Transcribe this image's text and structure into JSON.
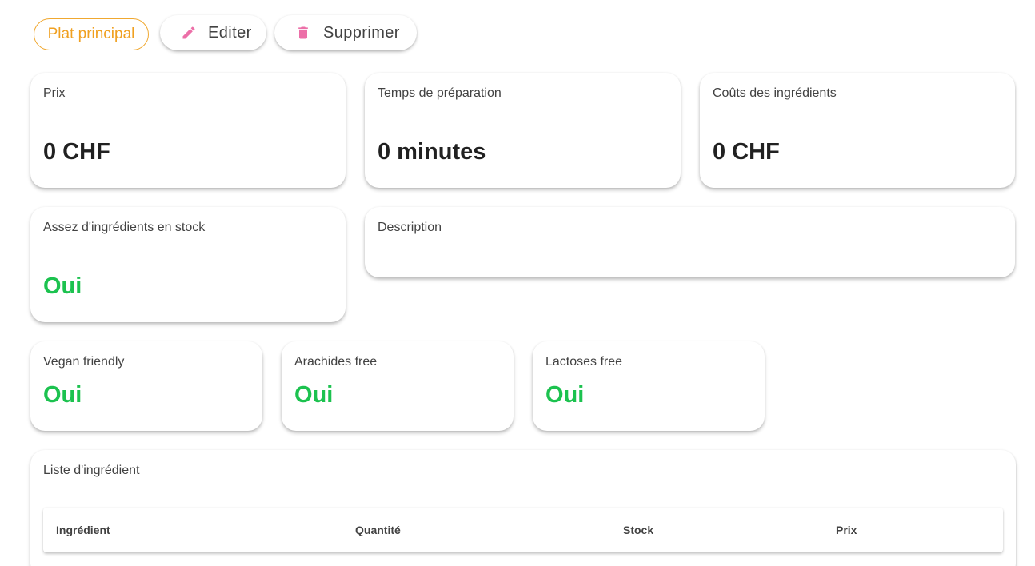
{
  "toolbar": {
    "category_chip": "Plat principal",
    "edit_label": "Editer",
    "delete_label": "Supprimer",
    "edit_icon": "pencil-icon",
    "delete_icon": "trash-icon"
  },
  "stats": {
    "price": {
      "label": "Prix",
      "value": "0 CHF"
    },
    "prep_time": {
      "label": "Temps de préparation",
      "value": "0 minutes"
    },
    "ingredient_cost": {
      "label": "Coûts des ingrédients",
      "value": "0 CHF"
    },
    "in_stock": {
      "label": "Assez d'ingrédients en stock",
      "value": "Oui"
    }
  },
  "description": {
    "label": "Description",
    "value": ""
  },
  "dietary": {
    "vegan": {
      "label": "Vegan friendly",
      "value": "Oui"
    },
    "peanut": {
      "label": "Arachides free",
      "value": "Oui"
    },
    "lactose": {
      "label": "Lactoses free",
      "value": "Oui"
    }
  },
  "ingredients": {
    "title": "Liste d'ingrédient",
    "columns": [
      "Ingrédient",
      "Quantité",
      "Stock",
      "Prix"
    ],
    "rows": []
  },
  "colors": {
    "chip_accent": "#f0a020",
    "positive": "#1cc24f",
    "icon_pink": "#ec6fa8"
  }
}
